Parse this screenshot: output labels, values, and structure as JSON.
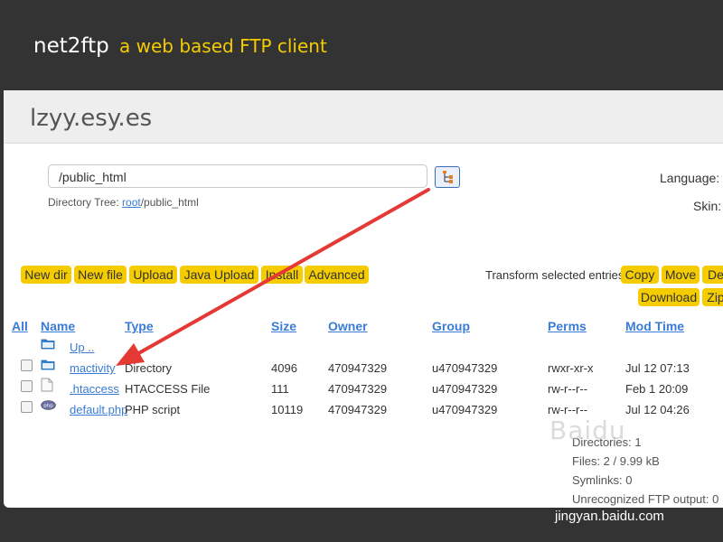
{
  "header": {
    "app_name": "net2ftp",
    "tagline": "a web based FTP client"
  },
  "host": "lzyy.esy.es",
  "directory": {
    "value": "/public_html",
    "tree_label": "Directory Tree:",
    "tree_root": "root",
    "tree_path": "/public_html"
  },
  "settings": {
    "language_label": "Language:",
    "skin_label": "Skin:"
  },
  "toolbar": {
    "buttons": [
      "New dir",
      "New file",
      "Upload",
      "Java Upload",
      "Install",
      "Advanced"
    ],
    "transform_label": "Transform selected entries:",
    "transform_buttons": [
      "Copy",
      "Move",
      "De",
      "Download",
      "Zip"
    ]
  },
  "table": {
    "headers": [
      "All",
      "Name",
      "Type",
      "Size",
      "Owner",
      "Group",
      "Perms",
      "Mod Time"
    ],
    "up_label": "Up ..",
    "rows": [
      {
        "icon": "folder-icon",
        "name": "mactivity",
        "type": "Directory",
        "size": "4096",
        "owner": "470947329",
        "group": "u470947329",
        "perms": "rwxr-xr-x",
        "modtime": "Jul 12 07:13"
      },
      {
        "icon": "file-icon",
        "name": ".htaccess",
        "type": "HTACCESS File",
        "size": "111",
        "owner": "470947329",
        "group": "u470947329",
        "perms": "rw-r--r--",
        "modtime": "Feb 1 20:09"
      },
      {
        "icon": "php-icon",
        "name": "default.php",
        "type": "PHP script",
        "size": "10119",
        "owner": "470947329",
        "group": "u470947329",
        "perms": "rw-r--r--",
        "modtime": "Jul 12 04:26"
      }
    ]
  },
  "stats": {
    "directories": "Directories: 1",
    "files": "Files: 2 / 9.99 kB",
    "symlinks": "Symlinks: 0",
    "unrecognized": "Unrecognized FTP output: 0"
  },
  "watermark": {
    "main": "Baidu",
    "sub": "jingyan.baidu.com"
  },
  "colors": {
    "accent": "#f5cc00",
    "link": "#3a7bd5",
    "header_bg": "#333333",
    "arrow": "#e53935"
  }
}
